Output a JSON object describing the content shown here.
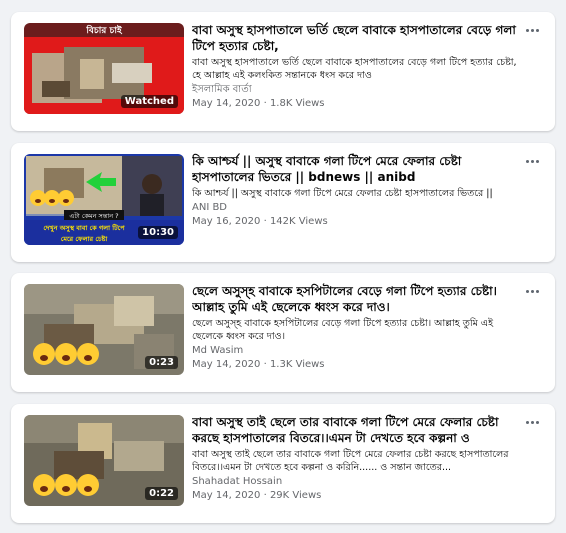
{
  "videos": [
    {
      "title": "বাবা অসুস্থ হাসপাতালে ভর্তি ছেলে বাবাকে হাসপাতালের বেড়ে গলা টিপে হত্যার চেষ্টা,",
      "description": "বাবা অসুস্থ হাসপাতালে ভর্তি ছেলে বাবাকে হাসপাতালের বেড়ে গলা টিপে হত্যার চেষ্টা, হে আল্লাহ এই কলংকিত সন্তানকে ধংস করে দাও",
      "author": "ইসলামিক বার্তা",
      "date": "May 14, 2020",
      "views": "1.8K Views",
      "badge": "Watched",
      "thumb_text": "বিচার চাই",
      "thumb_text2": "",
      "thumb_text3": ""
    },
    {
      "title": "কি আশ্চর্য || অসুস্থ বাবাকে গলা টিপে মেরে ফেলার চেষ্টা হাসপাতালের ভিতরে || bdnews || anibd",
      "description": "কি আশ্চর্য || অসুস্থ বাবাকে গলা টিপে মেরে ফেলার চেষ্টা হাসপাতালের ভিতরে ||",
      "author": "ANI BD",
      "date": "May 16, 2020",
      "views": "142K Views",
      "badge": "10:30",
      "thumb_text": "এটা কেমন সন্তান ?",
      "thumb_text2": "দেখুন অসুস্থ বাবা কে গলা টিপে",
      "thumb_text3": "মেরে ফেলার চেষ্টা"
    },
    {
      "title": "ছেলে অসুস্হ বাবাকে হসপিটালের বেড়ে গলা টিপে হত্যার চেষ্টা। আল্লাহ তুমি এই ছেলেকে ধ্বংস করে দাও।",
      "description": "ছেলে অসুস্হ বাবাকে হসপিটালের বেড়ে গলা টিপে হত্যার চেষ্টা। আল্লাহ তুমি এই ছেলেকে ধ্বংস করে দাও।",
      "author": "Md Wasim",
      "date": "May 14, 2020",
      "views": "1.3K Views",
      "badge": "0:23",
      "thumb_text": "",
      "thumb_text2": "",
      "thumb_text3": ""
    },
    {
      "title": "বাবা অসুস্থ তাই ছেলে তার বাবাকে গলা টিপে মেরে ফেলার চেষ্টা করছে হাসপাতালের বিতরে।।এমন টা দেখতে হবে কল্পনা ও করিনি......",
      "description": "বাবা অসুস্থ তাই ছেলে তার বাবাকে গলা টিপে মেরে ফেলার চেষ্টা করছে হাসপাতালের বিতরে।।এমন টা দেখতে হবে কল্পনা ও করিনি...... ও সন্তান জাতের...",
      "author": "Shahadat Hossain",
      "date": "May 14, 2020",
      "views": "29K Views",
      "badge": "0:22",
      "thumb_text": "",
      "thumb_text2": "",
      "thumb_text3": ""
    }
  ],
  "separator": " · ",
  "icons": {
    "more": "more-options-icon",
    "emoji": "crying-emoji-icon",
    "arrow": "green-arrow-icon"
  }
}
